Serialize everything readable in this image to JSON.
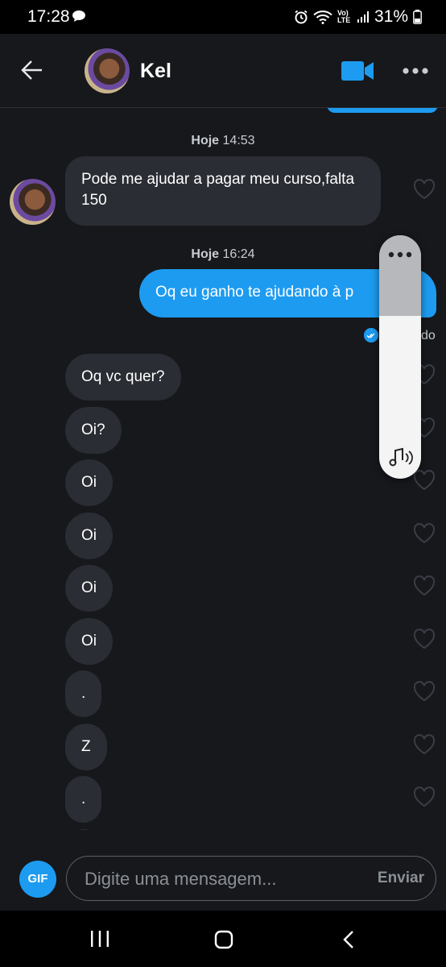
{
  "status_bar": {
    "time": "17:28",
    "network": "Vo) LTE",
    "battery": "31%"
  },
  "header": {
    "contact_name": "Kel"
  },
  "chat": {
    "date_sep_1": {
      "day": "Hoje",
      "time": "14:53"
    },
    "incoming_first": "Pode me ajudar a pagar meu curso,falta 150",
    "date_sep_2": {
      "day": "Hoje",
      "time": "16:24"
    },
    "outgoing": "Oq eu ganho te ajudando à p",
    "seen_fragment": "do",
    "incoming_messages": [
      {
        "text": "Oq vc quer?"
      },
      {
        "text": "Oi?"
      },
      {
        "text": "Oi"
      },
      {
        "text": "Oi"
      },
      {
        "text": "Oi"
      },
      {
        "text": "Oi"
      },
      {
        "text": "."
      },
      {
        "text": "Z"
      },
      {
        "text": "."
      }
    ]
  },
  "composer": {
    "gif_label": "GIF",
    "placeholder": "Digite uma mensagem...",
    "send_label": "Enviar"
  },
  "colors": {
    "accent": "#1d9bf0",
    "background": "#16181c",
    "bubble_incoming": "#2a2d33"
  }
}
